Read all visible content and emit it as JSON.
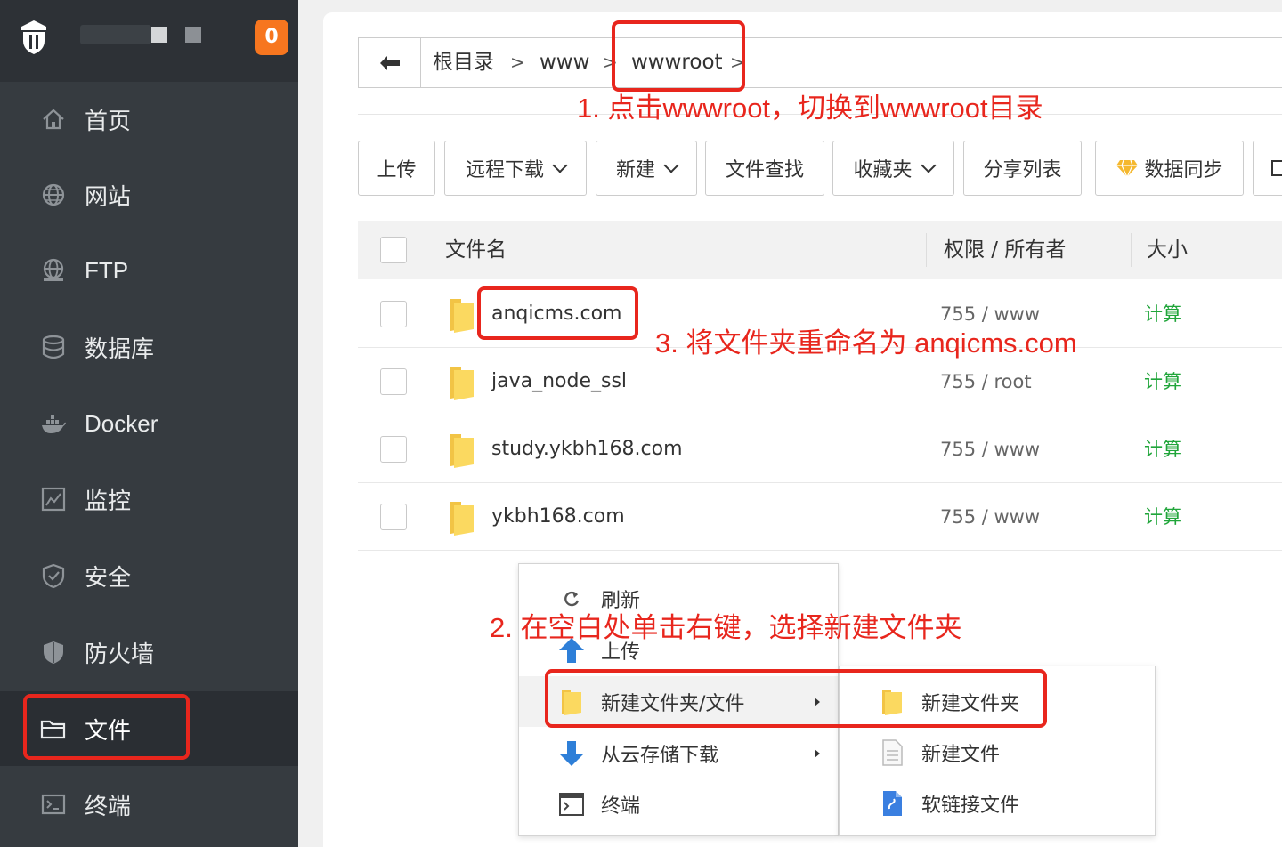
{
  "sidebar": {
    "notification_count": "0",
    "items": [
      {
        "label": "首页",
        "icon": "home-icon"
      },
      {
        "label": "网站",
        "icon": "globe-icon"
      },
      {
        "label": "FTP",
        "icon": "ftp-icon"
      },
      {
        "label": "数据库",
        "icon": "database-icon"
      },
      {
        "label": "Docker",
        "icon": "docker-icon"
      },
      {
        "label": "监控",
        "icon": "monitor-icon"
      },
      {
        "label": "安全",
        "icon": "shield-check-icon"
      },
      {
        "label": "防火墙",
        "icon": "firewall-icon"
      },
      {
        "label": "文件",
        "icon": "folder-icon"
      },
      {
        "label": "终端",
        "icon": "terminal-icon"
      }
    ],
    "active_item": "文件"
  },
  "breadcrumb": {
    "items": [
      "根目录",
      "www",
      "wwwroot"
    ],
    "separator": ">"
  },
  "annotations": {
    "step1": "1. 点击wwwroot，切换到wwwroot目录",
    "step2": "2. 在空白处单击右键，选择新建文件夹",
    "step3": "3. 将文件夹重命名为 anqicms.com"
  },
  "toolbar": {
    "upload": "上传",
    "remote_download": "远程下载",
    "new": "新建",
    "find": "文件查找",
    "favorites": "收藏夹",
    "share_list": "分享列表",
    "data_sync": "数据同步"
  },
  "table": {
    "columns": {
      "name": "文件名",
      "permission": "权限 / 所有者",
      "size": "大小"
    },
    "rows": [
      {
        "name": "anqicms.com",
        "permission": "755 / www",
        "size": "计算"
      },
      {
        "name": "java_node_ssl",
        "permission": "755 / root",
        "size": "计算"
      },
      {
        "name": "study.ykbh168.com",
        "permission": "755 / www",
        "size": "计算"
      },
      {
        "name": "ykbh168.com",
        "permission": "755 / www",
        "size": "计算"
      }
    ]
  },
  "context_menu": {
    "items": [
      {
        "label": "刷新",
        "icon": "refresh-icon"
      },
      {
        "label": "上传",
        "icon": "upload-arrow-icon"
      },
      {
        "label": "新建文件夹/文件",
        "icon": "folder-icon"
      },
      {
        "label": "从云存储下载",
        "icon": "download-arrow-icon"
      },
      {
        "label": "终端",
        "icon": "terminal-icon"
      }
    ],
    "submenu": [
      {
        "label": "新建文件夹",
        "icon": "folder-icon"
      },
      {
        "label": "新建文件",
        "icon": "file-icon"
      },
      {
        "label": "软链接文件",
        "icon": "symlink-file-icon"
      }
    ]
  },
  "colors": {
    "sidebar_bg": "#363b40",
    "accent_green": "#20a53a",
    "annotation_red": "#e8261d",
    "badge_orange": "#f7761f"
  }
}
